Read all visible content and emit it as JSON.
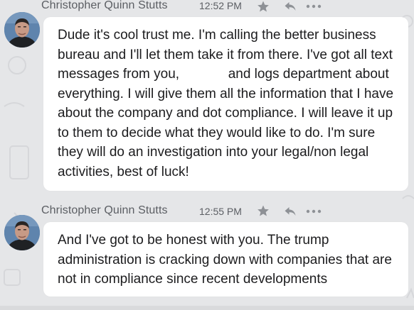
{
  "conversation": {
    "messages": [
      {
        "sender": "Christopher Quinn Stutts",
        "time": "12:52 PM",
        "text": "Dude it's cool trust me. I'm calling the better business bureau and I'll let them take it from there. I've got all text messages from you,             and logs department about everything. I will give them all the information that I have about the company and dot compliance. I will leave it up to them to decide what they would like to do. I'm sure they will do an investigation into your legal/non legal activities, best of luck!",
        "icons": [
          "star-icon",
          "reply-icon",
          "more-icon"
        ]
      },
      {
        "sender": "Christopher Quinn Stutts",
        "time": "12:55 PM",
        "text": "And I've got to be honest with you. The trump administration is cracking down with companies that are not in compliance since recent developments",
        "icons": [
          "star-icon",
          "reply-icon",
          "more-icon"
        ]
      }
    ]
  },
  "colors": {
    "background": "#e5e6e8",
    "bubble": "#ffffff",
    "text": "#1c1c1e",
    "meta": "#5b5e63",
    "icon": "#8e9196"
  }
}
